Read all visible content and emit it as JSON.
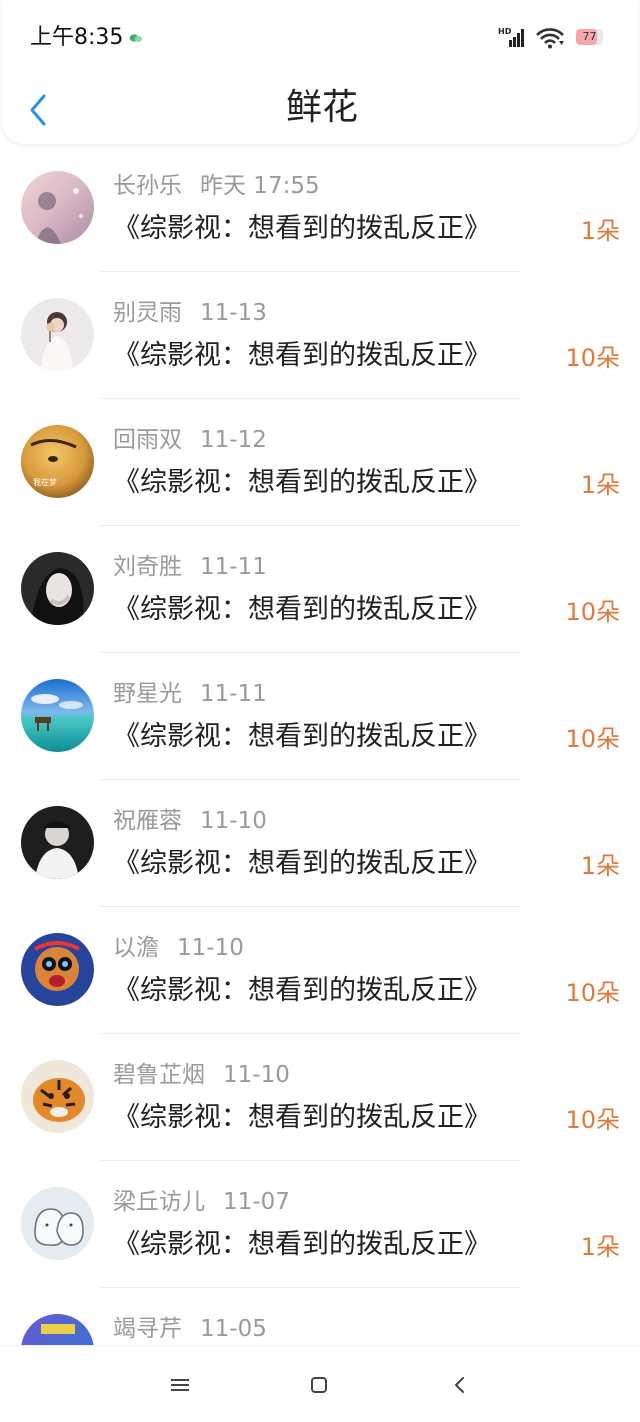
{
  "status_bar": {
    "time": "上午8:35",
    "battery_level": "77",
    "battery_fraction": 0.77
  },
  "header": {
    "title": "鲜花",
    "back_icon": "chevron-left-icon"
  },
  "colors": {
    "accent": "#e07a3a",
    "back_blue": "#2b8fe6",
    "meta_gray": "#9a9a9a",
    "text": "#222222"
  },
  "rows": [
    {
      "name": "长孙乐",
      "time": "昨天 17:55",
      "book": "《综影视：想看到的拨乱反正》",
      "flowers": "1朵"
    },
    {
      "name": "别灵雨",
      "time": "11-13",
      "book": "《综影视：想看到的拨乱反正》",
      "flowers": "10朵"
    },
    {
      "name": "回雨双",
      "time": "11-12",
      "book": "《综影视：想看到的拨乱反正》",
      "flowers": "1朵"
    },
    {
      "name": "刘奇胜",
      "time": "11-11",
      "book": "《综影视：想看到的拨乱反正》",
      "flowers": "10朵"
    },
    {
      "name": "野星光",
      "time": "11-11",
      "book": "《综影视：想看到的拨乱反正》",
      "flowers": "10朵"
    },
    {
      "name": "祝雁蓉",
      "time": "11-10",
      "book": "《综影视：想看到的拨乱反正》",
      "flowers": "1朵"
    },
    {
      "name": "以澹",
      "time": "11-10",
      "book": "《综影视：想看到的拨乱反正》",
      "flowers": "10朵"
    },
    {
      "name": "碧鲁芷烟",
      "time": "11-10",
      "book": "《综影视：想看到的拨乱反正》",
      "flowers": "10朵"
    },
    {
      "name": "梁丘访儿",
      "time": "11-07",
      "book": "《综影视：想看到的拨乱反正》",
      "flowers": "1朵"
    },
    {
      "name": "竭寻芹",
      "time": "11-05",
      "book": "",
      "flowers": ""
    }
  ],
  "avatar_icons": [
    "avatar-pink-icon",
    "avatar-girl-icon",
    "avatar-face-icon",
    "avatar-dark-icon",
    "avatar-sea-icon",
    "avatar-man-icon",
    "avatar-cartoon-icon",
    "avatar-tiger-icon",
    "avatar-sketch-icon",
    "avatar-purple-icon"
  ],
  "avatar_caption_3": "我在梦",
  "navbar": {
    "menu_icon": "menu-icon",
    "home_icon": "square-icon",
    "back_icon": "triangle-back-icon"
  }
}
